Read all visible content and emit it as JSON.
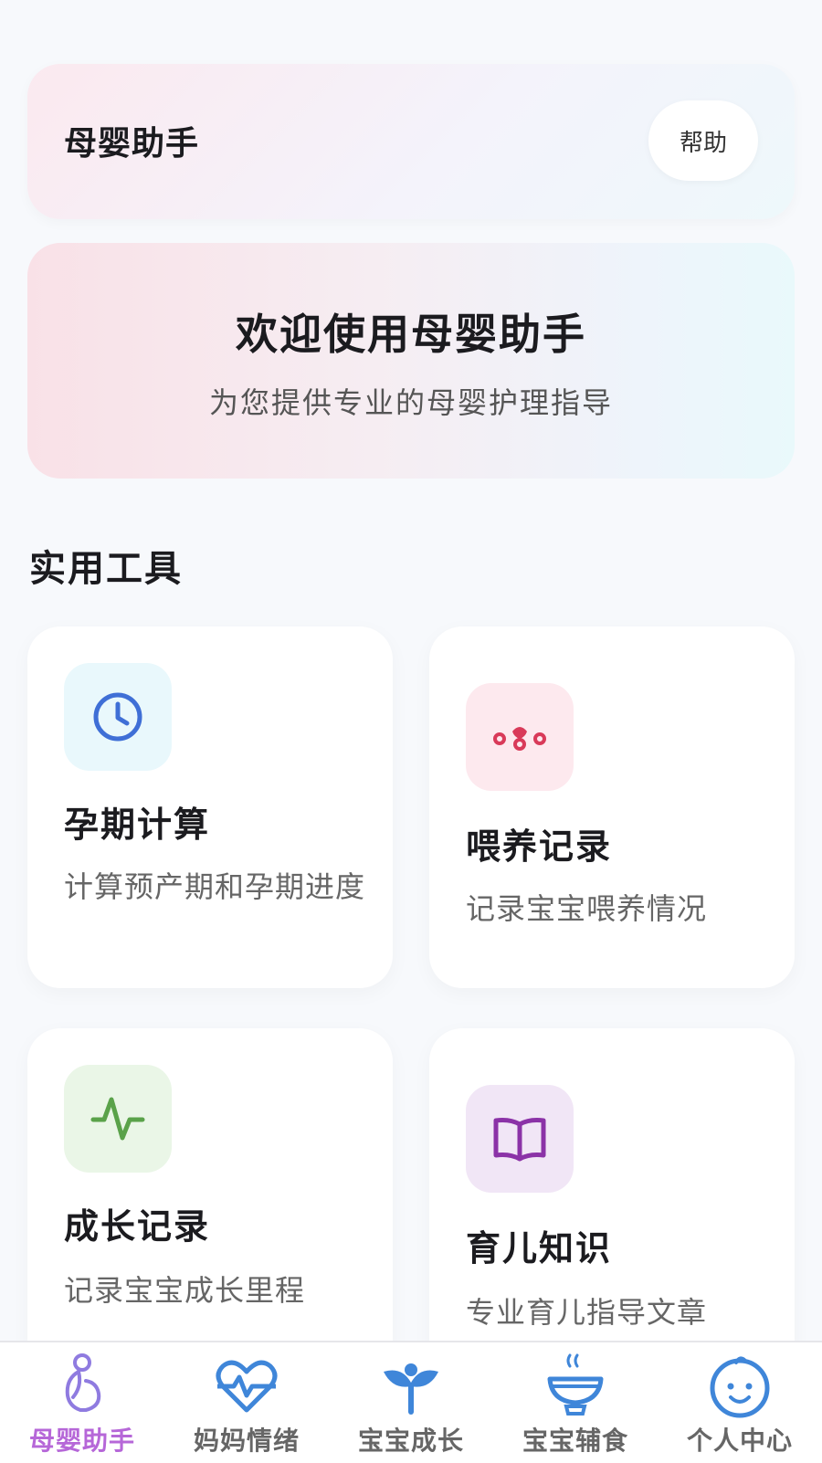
{
  "header": {
    "title": "母婴助手",
    "help_label": "帮助"
  },
  "welcome": {
    "title": "欢迎使用母婴助手",
    "subtitle": "为您提供专业的母婴护理指导"
  },
  "tools_section": {
    "title": "实用工具"
  },
  "tools": [
    {
      "title": "孕期计算",
      "desc": "计算预产期和孕期进度",
      "icon": "clock-icon",
      "icon_bg": "#e9f8fc",
      "icon_color": "#3f6fd6"
    },
    {
      "title": "喂养记录",
      "desc": "记录宝宝喂养情况",
      "icon": "feeding-icon",
      "icon_bg": "#fde9ee",
      "icon_color": "#d93a59"
    },
    {
      "title": "成长记录",
      "desc": "记录宝宝成长里程",
      "icon": "activity-icon",
      "icon_bg": "#eaf6e7",
      "icon_color": "#5aa24a"
    },
    {
      "title": "育儿知识",
      "desc": "专业育儿指导文章",
      "icon": "book-icon",
      "icon_bg": "#f1e6f6",
      "icon_color": "#8b32a7"
    }
  ],
  "nav": [
    {
      "label": "母婴助手",
      "icon": "pregnant-icon",
      "active": true
    },
    {
      "label": "妈妈情绪",
      "icon": "heart-pulse-icon",
      "active": false
    },
    {
      "label": "宝宝成长",
      "icon": "sprout-icon",
      "active": false
    },
    {
      "label": "宝宝辅食",
      "icon": "bowl-icon",
      "active": false
    },
    {
      "label": "个人中心",
      "icon": "baby-face-icon",
      "active": false
    }
  ],
  "colors": {
    "accent": "#b667d8",
    "nav_icon": "#3f86d9"
  }
}
